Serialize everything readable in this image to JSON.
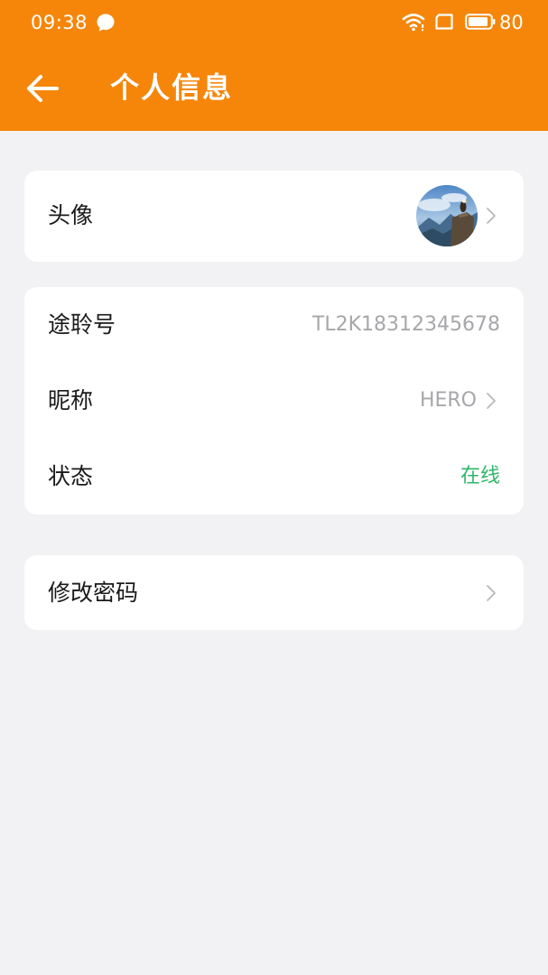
{
  "status_bar": {
    "time": "09:38",
    "battery_level": "80",
    "icons": [
      "message-bubble-icon",
      "wifi-icon",
      "sim-card-icon",
      "battery-icon"
    ]
  },
  "header": {
    "title": "个人信息",
    "back_icon": "arrow-left-icon",
    "background_color": "#f5860a"
  },
  "profile": {
    "avatar_label": "头像",
    "avatar_image": "mountain-eagle-avatar"
  },
  "info": {
    "account_id_label": "途聆号",
    "account_id_value": "TL2K18312345678",
    "nickname_label": "昵称",
    "nickname_value": "HERO",
    "status_label": "状态",
    "status_value": "在线",
    "status_color": "#2fb66b"
  },
  "security": {
    "change_password_label": "修改密码"
  }
}
